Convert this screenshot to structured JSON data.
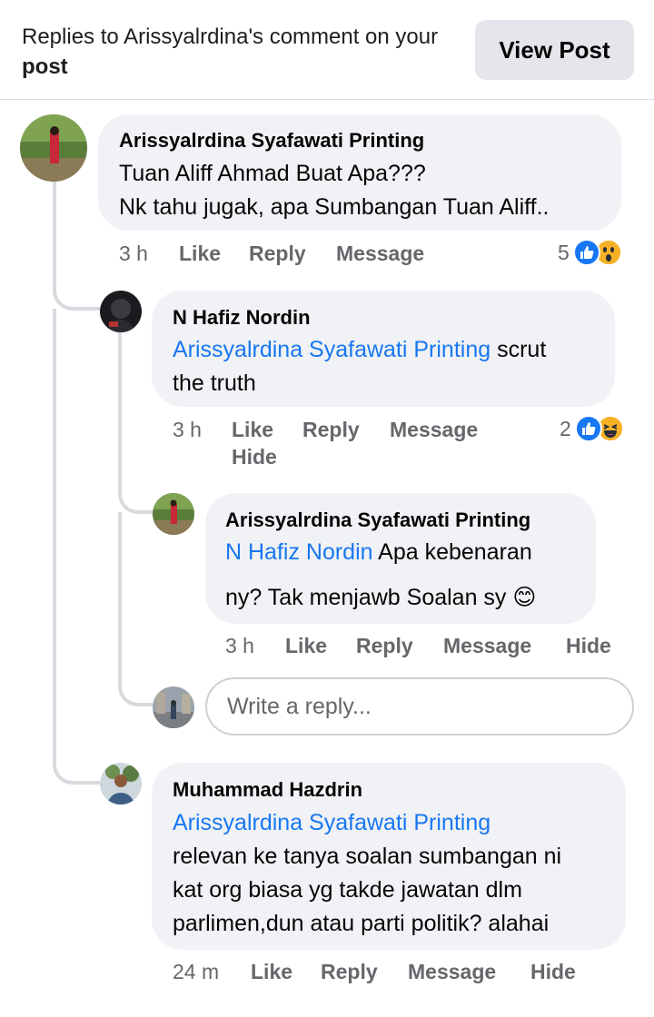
{
  "header": {
    "title_prefix": "Replies to Arissyalrdina's comment on your",
    "title_bold": "post",
    "view_post_label": "View Post"
  },
  "comments": [
    {
      "author": "Arissyalrdina Syafawati Printing",
      "lines": [
        "Tuan Aliff Ahmad Buat Apa???",
        "Nk tahu jugak, apa Sumbangan Tuan Aliff.."
      ],
      "time": "3 h",
      "like": "Like",
      "reply": "Reply",
      "message": "Message",
      "reaction_count": "5",
      "reaction_icons": [
        "like-icon",
        "wow-emoji-icon"
      ]
    },
    {
      "author": "N Hafiz Nordin",
      "mention": "Arissyalrdina Syafawati Printing",
      "text_after_mention": "scrut",
      "line2": "the truth",
      "time": "3 h",
      "like": "Like",
      "reply": "Reply",
      "message": "Message",
      "hide": "Hide",
      "reaction_count": "2",
      "reaction_icons": [
        "like-icon",
        "laugh-emoji-icon"
      ]
    },
    {
      "author": "Arissyalrdina Syafawati Printing",
      "mention": "N Hafiz Nordin",
      "text_after_mention": "Apa kebenaran",
      "line2": "ny? Tak menjawb Soalan sy",
      "emoji": "😊",
      "time": "3 h",
      "like": "Like",
      "reply": "Reply",
      "message": "Message",
      "hide": "Hide"
    },
    {
      "author": "Muhammad Hazdrin",
      "mention": "Arissyalrdina Syafawati Printing",
      "lines": [
        "relevan ke tanya soalan sumbangan ni",
        "kat org biasa yg takde jawatan dlm",
        "parlimen,dun atau parti politik? alahai"
      ],
      "time": "24 m",
      "like": "Like",
      "reply": "Reply",
      "message": "Message",
      "hide": "Hide"
    }
  ],
  "reply_input": {
    "placeholder": "Write a reply..."
  },
  "colors": {
    "link": "#1877f2",
    "bubble": "#f0f2f5",
    "meta": "#65676b",
    "button_bg": "#e4e6eb"
  }
}
